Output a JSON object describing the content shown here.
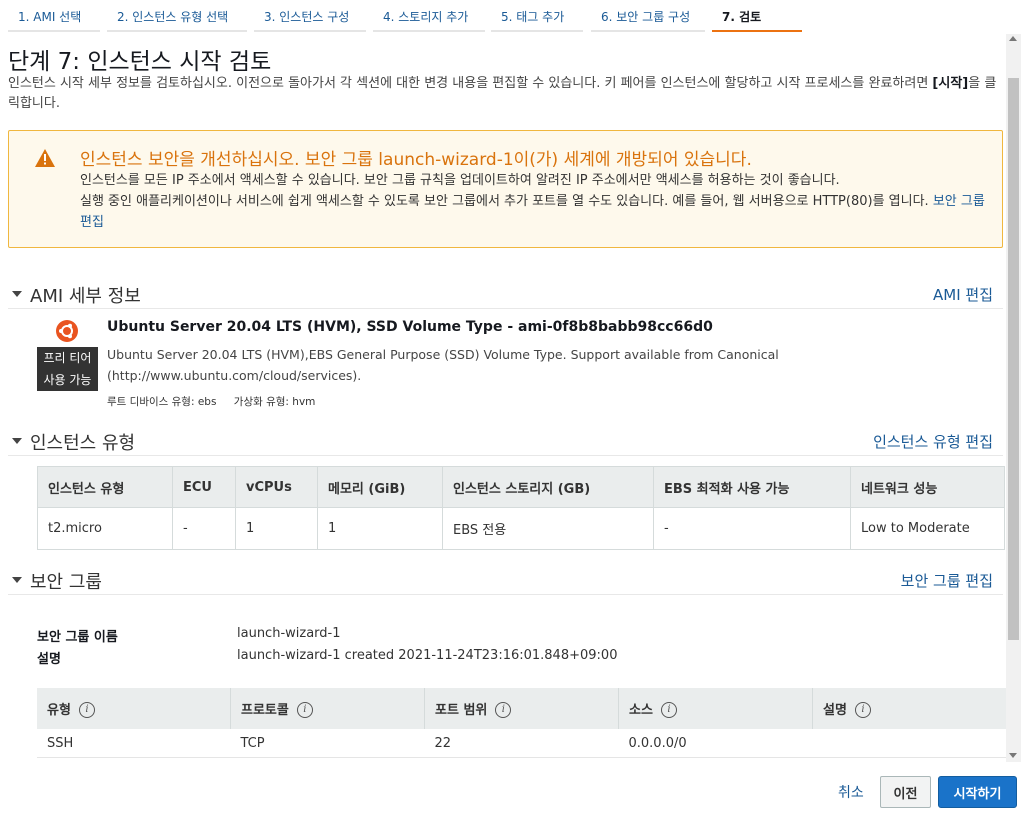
{
  "steps": [
    {
      "label": "1. AMI 선택"
    },
    {
      "label": "2. 인스턴스 유형 선택"
    },
    {
      "label": "3. 인스턴스 구성"
    },
    {
      "label": "4. 스토리지 추가"
    },
    {
      "label": "5. 태그 추가"
    },
    {
      "label": "6. 보안 그룹 구성"
    },
    {
      "label": "7. 검토"
    }
  ],
  "page": {
    "title": "단계 7: 인스턴스 시작 검토",
    "intro_pre": "인스턴스 시작 세부 정보를 검토하십시오. 이전으로 돌아가서 각 섹션에 대한 변경 내용을 편집할 수 있습니다. 키 페어를 인스턴스에 할당하고 시작 프로세스를 완료하려면 ",
    "intro_bold": "[시작]",
    "intro_post": "을 클릭합니다."
  },
  "warning": {
    "title": "인스턴스 보안을 개선하십시오. 보안 그룹 launch-wizard-1이(가) 세계에 개방되어 있습니다.",
    "line1": "인스턴스를 모든 IP 주소에서 액세스할 수 있습니다. 보안 그룹 규칙을 업데이트하여 알려진 IP 주소에서만 액세스를 허용하는 것이 좋습니다.",
    "line2": "실행 중인 애플리케이션이나 서비스에 쉽게 액세스할 수 있도록 보안 그룹에서 추가 포트를 열 수도 있습니다. 예를 들어, 웹 서버용으로 HTTP(80)를 엽니다.",
    "link": "보안 그룹 편집",
    "color": "#d9730d"
  },
  "ami": {
    "section_title": "AMI 세부 정보",
    "edit_link": "AMI 편집",
    "name": "Ubuntu Server 20.04 LTS (HVM), SSD Volume Type - ami-0f8b8babb98cc66d0",
    "badge_line1": "프리 티어",
    "badge_line2": "사용 가능",
    "desc_line1": "Ubuntu Server 20.04 LTS (HVM),EBS General Purpose (SSD) Volume Type. Support available from Canonical",
    "desc_line2": "(http://www.ubuntu.com/cloud/services).",
    "root_device": "루트 디바이스 유형: ebs",
    "virt_type": "가상화 유형: hvm",
    "logo_icon": "ubuntu-logo-icon",
    "logo_color": "#e95420"
  },
  "instance_type": {
    "section_title": "인스턴스 유형",
    "edit_link": "인스턴스 유형 편집",
    "headers": [
      "인스턴스 유형",
      "ECU",
      "vCPUs",
      "메모리 (GiB)",
      "인스턴스 스토리지 (GB)",
      "EBS 최적화 사용 가능",
      "네트워크 성능"
    ],
    "row": [
      "t2.micro",
      "-",
      "1",
      "1",
      "EBS 전용",
      "-",
      "Low to Moderate"
    ]
  },
  "security_group": {
    "section_title": "보안 그룹",
    "edit_link": "보안 그룹 편집",
    "name_label": "보안 그룹 이름",
    "name_value": "launch-wizard-1",
    "desc_label": "설명",
    "desc_value": "launch-wizard-1 created 2021-11-24T23:16:01.848+09:00",
    "rule_headers": [
      "유형",
      "프로토콜",
      "포트 범위",
      "소스",
      "설명"
    ],
    "rule_row": [
      "SSH",
      "TCP",
      "22",
      "0.0.0.0/0",
      ""
    ]
  },
  "footer": {
    "cancel": "취소",
    "previous": "이전",
    "launch": "시작하기",
    "launch_color": "#1a73c9"
  }
}
